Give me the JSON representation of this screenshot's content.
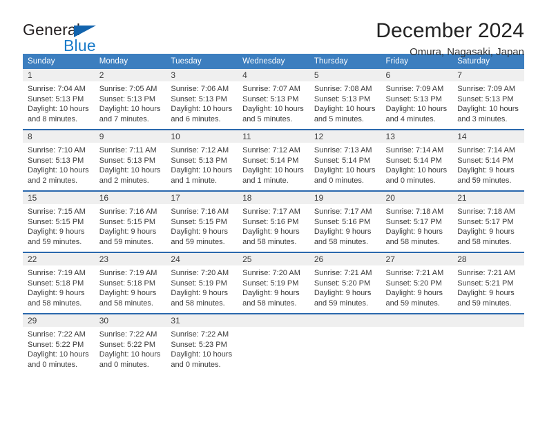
{
  "logo": {
    "part1": "General",
    "part2": "Blue",
    "triangle_color": "#1263ad",
    "blue_color": "#1a7bc9"
  },
  "header": {
    "title": "December 2024",
    "subtitle": "Omura, Nagasaki, Japan"
  },
  "theme": {
    "header_bg": "#3c7ebf",
    "row_divider": "#2a68ad",
    "daynum_bg": "#efefef"
  },
  "weekdays": [
    "Sunday",
    "Monday",
    "Tuesday",
    "Wednesday",
    "Thursday",
    "Friday",
    "Saturday"
  ],
  "weeks": [
    [
      {
        "day": "1",
        "l1": "Sunrise: 7:04 AM",
        "l2": "Sunset: 5:13 PM",
        "l3": "Daylight: 10 hours",
        "l4": "and 8 minutes."
      },
      {
        "day": "2",
        "l1": "Sunrise: 7:05 AM",
        "l2": "Sunset: 5:13 PM",
        "l3": "Daylight: 10 hours",
        "l4": "and 7 minutes."
      },
      {
        "day": "3",
        "l1": "Sunrise: 7:06 AM",
        "l2": "Sunset: 5:13 PM",
        "l3": "Daylight: 10 hours",
        "l4": "and 6 minutes."
      },
      {
        "day": "4",
        "l1": "Sunrise: 7:07 AM",
        "l2": "Sunset: 5:13 PM",
        "l3": "Daylight: 10 hours",
        "l4": "and 5 minutes."
      },
      {
        "day": "5",
        "l1": "Sunrise: 7:08 AM",
        "l2": "Sunset: 5:13 PM",
        "l3": "Daylight: 10 hours",
        "l4": "and 5 minutes."
      },
      {
        "day": "6",
        "l1": "Sunrise: 7:09 AM",
        "l2": "Sunset: 5:13 PM",
        "l3": "Daylight: 10 hours",
        "l4": "and 4 minutes."
      },
      {
        "day": "7",
        "l1": "Sunrise: 7:09 AM",
        "l2": "Sunset: 5:13 PM",
        "l3": "Daylight: 10 hours",
        "l4": "and 3 minutes."
      }
    ],
    [
      {
        "day": "8",
        "l1": "Sunrise: 7:10 AM",
        "l2": "Sunset: 5:13 PM",
        "l3": "Daylight: 10 hours",
        "l4": "and 2 minutes."
      },
      {
        "day": "9",
        "l1": "Sunrise: 7:11 AM",
        "l2": "Sunset: 5:13 PM",
        "l3": "Daylight: 10 hours",
        "l4": "and 2 minutes."
      },
      {
        "day": "10",
        "l1": "Sunrise: 7:12 AM",
        "l2": "Sunset: 5:13 PM",
        "l3": "Daylight: 10 hours",
        "l4": "and 1 minute."
      },
      {
        "day": "11",
        "l1": "Sunrise: 7:12 AM",
        "l2": "Sunset: 5:14 PM",
        "l3": "Daylight: 10 hours",
        "l4": "and 1 minute."
      },
      {
        "day": "12",
        "l1": "Sunrise: 7:13 AM",
        "l2": "Sunset: 5:14 PM",
        "l3": "Daylight: 10 hours",
        "l4": "and 0 minutes."
      },
      {
        "day": "13",
        "l1": "Sunrise: 7:14 AM",
        "l2": "Sunset: 5:14 PM",
        "l3": "Daylight: 10 hours",
        "l4": "and 0 minutes."
      },
      {
        "day": "14",
        "l1": "Sunrise: 7:14 AM",
        "l2": "Sunset: 5:14 PM",
        "l3": "Daylight: 9 hours",
        "l4": "and 59 minutes."
      }
    ],
    [
      {
        "day": "15",
        "l1": "Sunrise: 7:15 AM",
        "l2": "Sunset: 5:15 PM",
        "l3": "Daylight: 9 hours",
        "l4": "and 59 minutes."
      },
      {
        "day": "16",
        "l1": "Sunrise: 7:16 AM",
        "l2": "Sunset: 5:15 PM",
        "l3": "Daylight: 9 hours",
        "l4": "and 59 minutes."
      },
      {
        "day": "17",
        "l1": "Sunrise: 7:16 AM",
        "l2": "Sunset: 5:15 PM",
        "l3": "Daylight: 9 hours",
        "l4": "and 59 minutes."
      },
      {
        "day": "18",
        "l1": "Sunrise: 7:17 AM",
        "l2": "Sunset: 5:16 PM",
        "l3": "Daylight: 9 hours",
        "l4": "and 58 minutes."
      },
      {
        "day": "19",
        "l1": "Sunrise: 7:17 AM",
        "l2": "Sunset: 5:16 PM",
        "l3": "Daylight: 9 hours",
        "l4": "and 58 minutes."
      },
      {
        "day": "20",
        "l1": "Sunrise: 7:18 AM",
        "l2": "Sunset: 5:17 PM",
        "l3": "Daylight: 9 hours",
        "l4": "and 58 minutes."
      },
      {
        "day": "21",
        "l1": "Sunrise: 7:18 AM",
        "l2": "Sunset: 5:17 PM",
        "l3": "Daylight: 9 hours",
        "l4": "and 58 minutes."
      }
    ],
    [
      {
        "day": "22",
        "l1": "Sunrise: 7:19 AM",
        "l2": "Sunset: 5:18 PM",
        "l3": "Daylight: 9 hours",
        "l4": "and 58 minutes."
      },
      {
        "day": "23",
        "l1": "Sunrise: 7:19 AM",
        "l2": "Sunset: 5:18 PM",
        "l3": "Daylight: 9 hours",
        "l4": "and 58 minutes."
      },
      {
        "day": "24",
        "l1": "Sunrise: 7:20 AM",
        "l2": "Sunset: 5:19 PM",
        "l3": "Daylight: 9 hours",
        "l4": "and 58 minutes."
      },
      {
        "day": "25",
        "l1": "Sunrise: 7:20 AM",
        "l2": "Sunset: 5:19 PM",
        "l3": "Daylight: 9 hours",
        "l4": "and 58 minutes."
      },
      {
        "day": "26",
        "l1": "Sunrise: 7:21 AM",
        "l2": "Sunset: 5:20 PM",
        "l3": "Daylight: 9 hours",
        "l4": "and 59 minutes."
      },
      {
        "day": "27",
        "l1": "Sunrise: 7:21 AM",
        "l2": "Sunset: 5:20 PM",
        "l3": "Daylight: 9 hours",
        "l4": "and 59 minutes."
      },
      {
        "day": "28",
        "l1": "Sunrise: 7:21 AM",
        "l2": "Sunset: 5:21 PM",
        "l3": "Daylight: 9 hours",
        "l4": "and 59 minutes."
      }
    ],
    [
      {
        "day": "29",
        "l1": "Sunrise: 7:22 AM",
        "l2": "Sunset: 5:22 PM",
        "l3": "Daylight: 10 hours",
        "l4": "and 0 minutes."
      },
      {
        "day": "30",
        "l1": "Sunrise: 7:22 AM",
        "l2": "Sunset: 5:22 PM",
        "l3": "Daylight: 10 hours",
        "l4": "and 0 minutes."
      },
      {
        "day": "31",
        "l1": "Sunrise: 7:22 AM",
        "l2": "Sunset: 5:23 PM",
        "l3": "Daylight: 10 hours",
        "l4": "and 0 minutes."
      },
      {
        "day": "",
        "l1": "",
        "l2": "",
        "l3": "",
        "l4": ""
      },
      {
        "day": "",
        "l1": "",
        "l2": "",
        "l3": "",
        "l4": ""
      },
      {
        "day": "",
        "l1": "",
        "l2": "",
        "l3": "",
        "l4": ""
      },
      {
        "day": "",
        "l1": "",
        "l2": "",
        "l3": "",
        "l4": ""
      }
    ]
  ]
}
